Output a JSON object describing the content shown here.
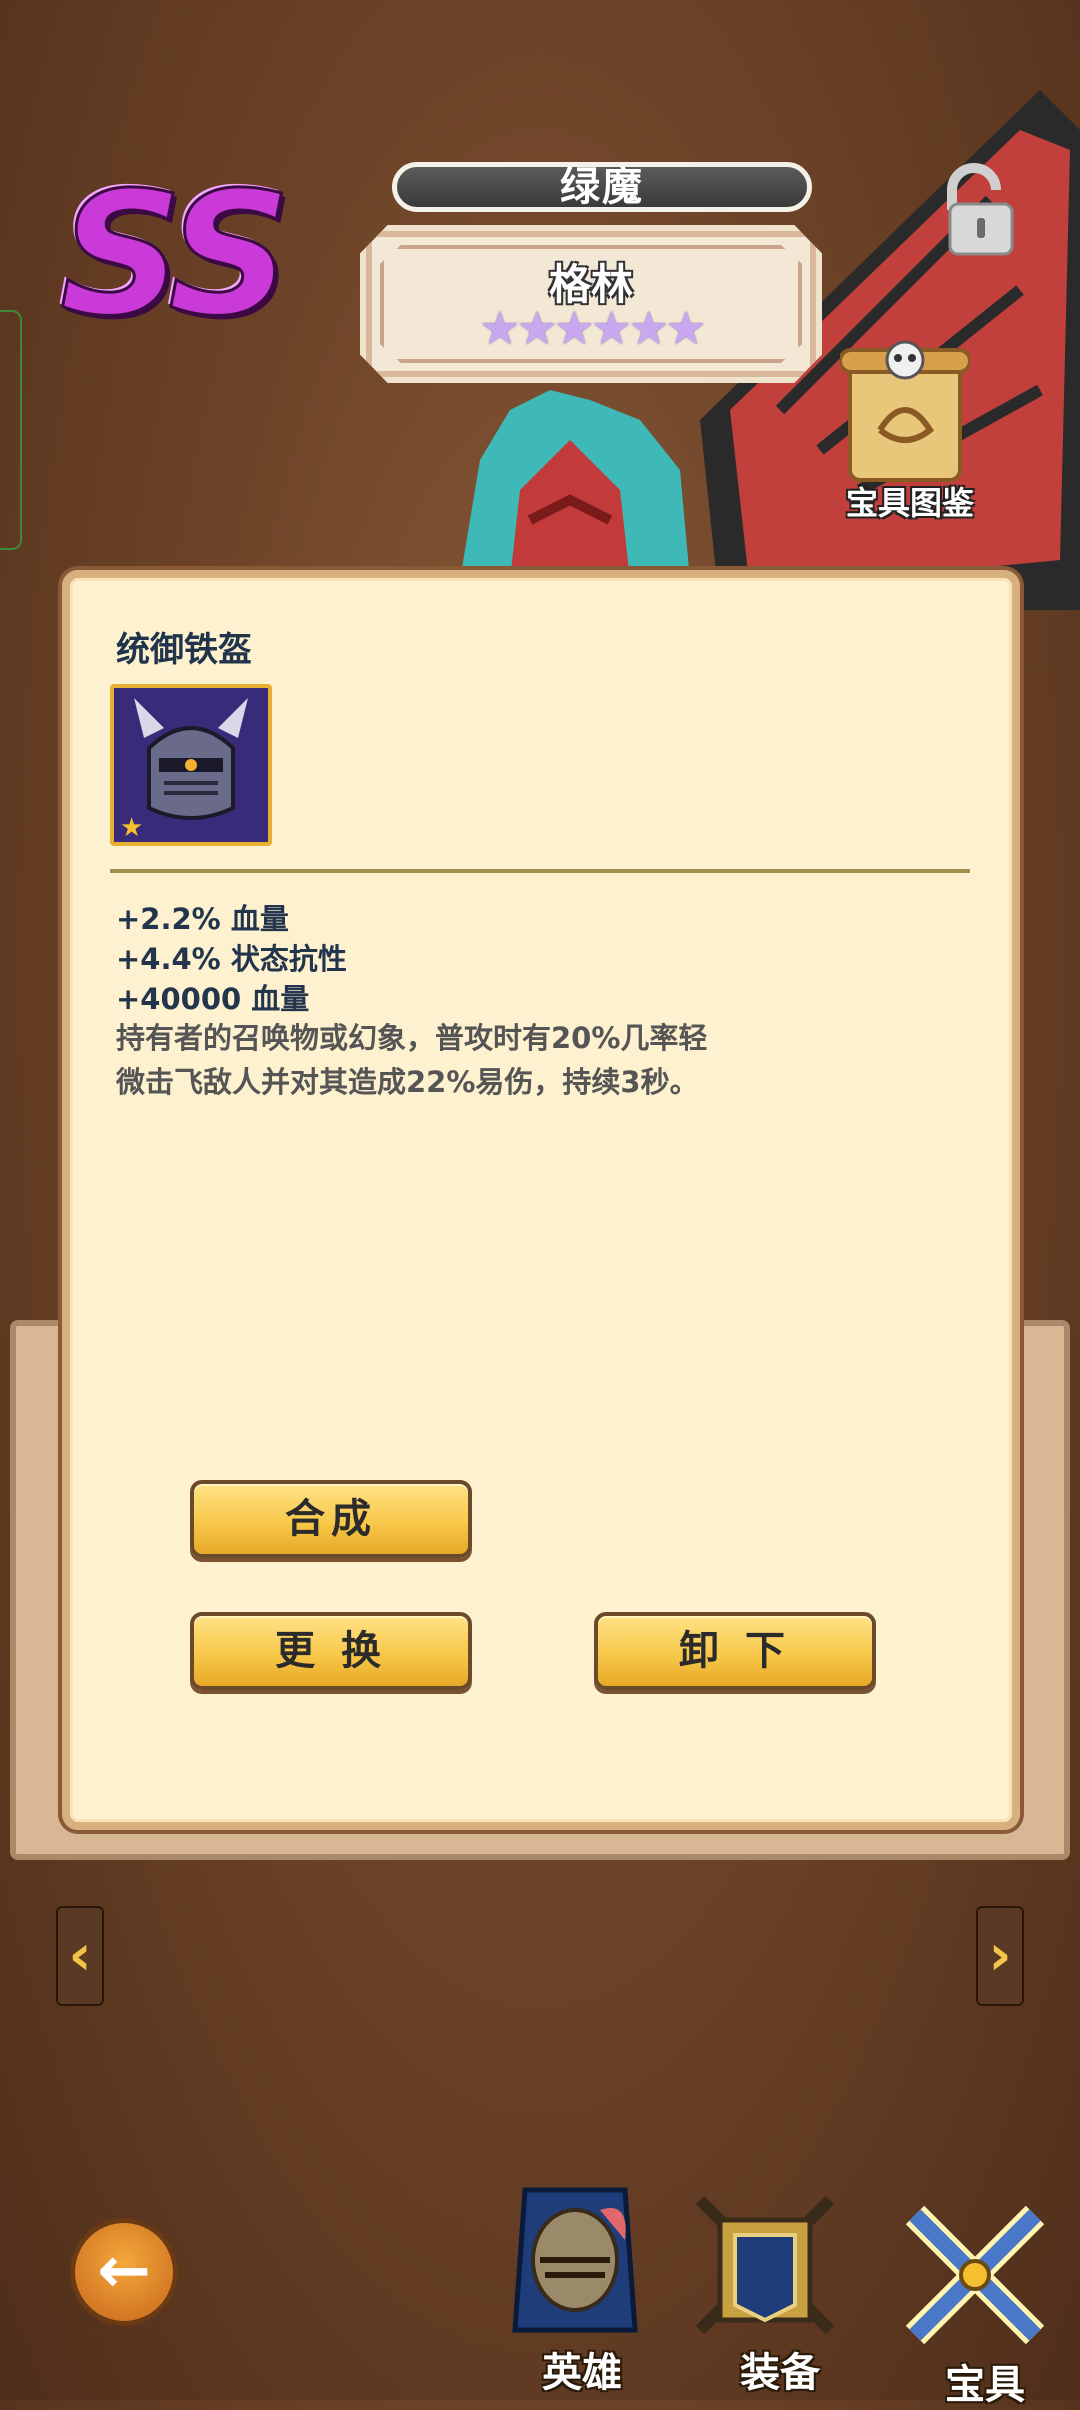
{
  "rank": "SS",
  "hero": {
    "class": "绿魔",
    "name": "格林",
    "stars": "★★★★★★"
  },
  "codex_label": "宝具图鉴",
  "item": {
    "name": "统御铁盔",
    "stats": [
      "+2.2% 血量",
      "+4.4% 状态抗性",
      "+40000 血量"
    ],
    "desc_line1": "持有者的召唤物或幻象，普攻时有20%几率轻",
    "desc_line2": "微击飞敌人并对其造成22%易伤，持续3秒。"
  },
  "buttons": {
    "compose": "合成",
    "replace": "更 换",
    "unequip": "卸 下"
  },
  "nav": {
    "prev": "‹",
    "next": "›",
    "back": "←"
  },
  "tabs": {
    "heroes": "英雄",
    "equipment": "装备",
    "artifacts": "宝具"
  }
}
